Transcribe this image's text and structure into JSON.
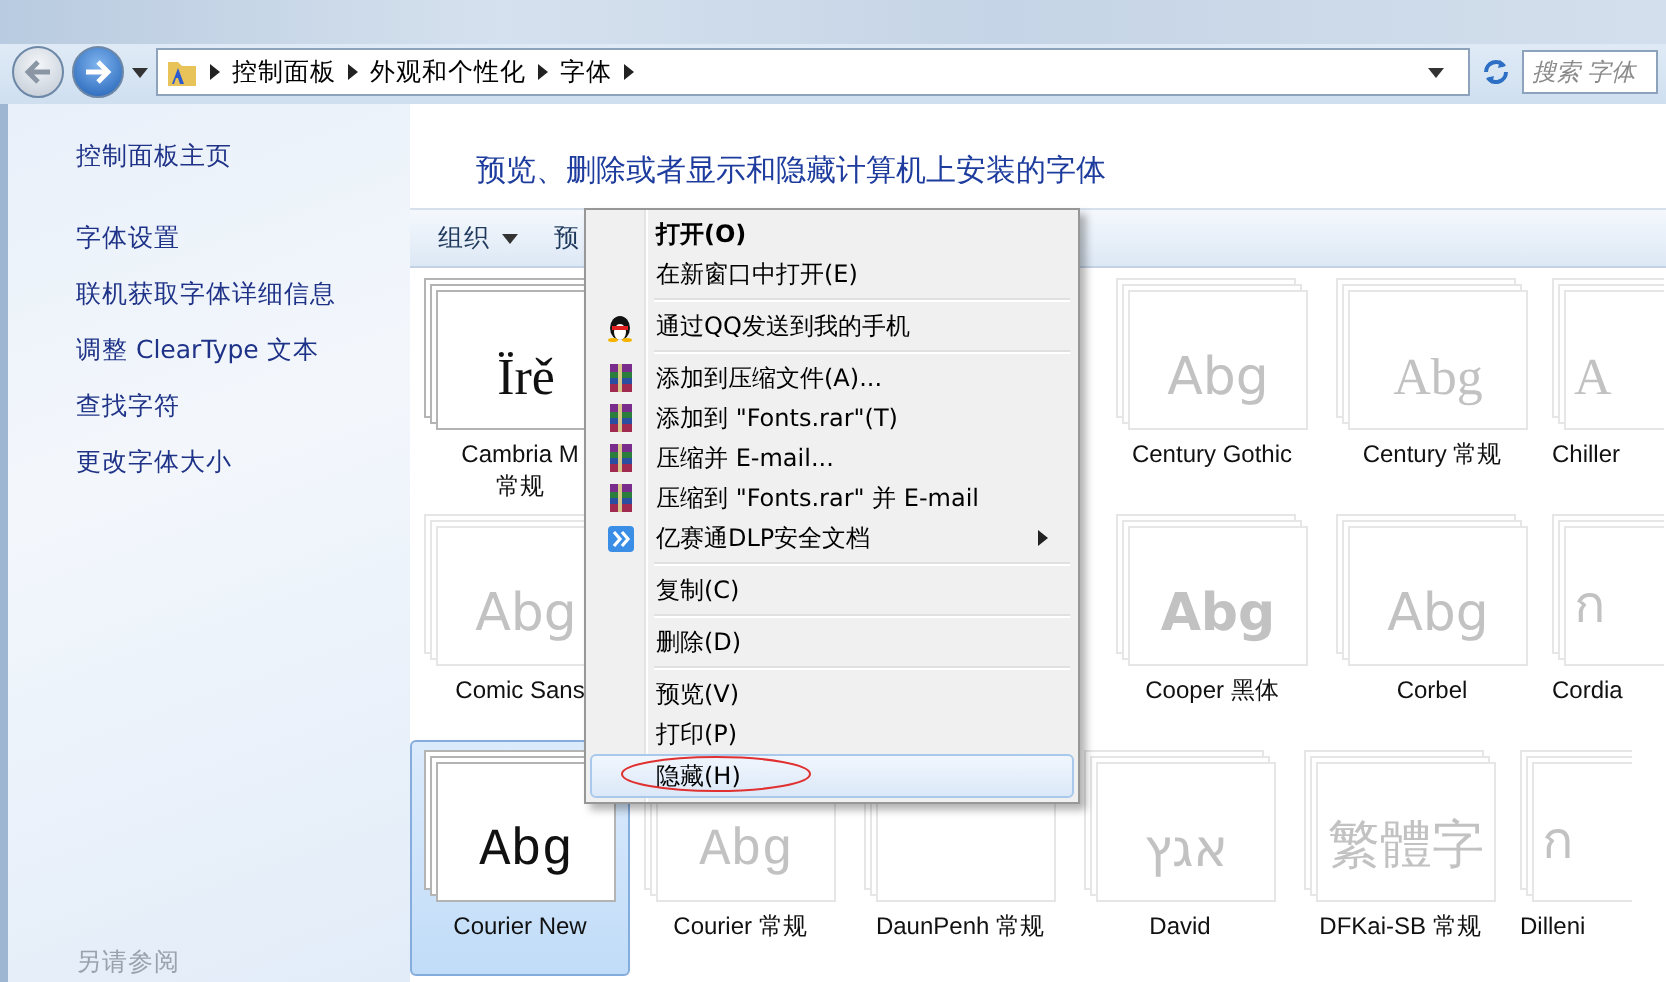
{
  "address_bar": {
    "crumbs": [
      "控制面板",
      "外观和个性化",
      "字体"
    ]
  },
  "search": {
    "placeholder": "搜索 字体"
  },
  "sidebar": {
    "items": [
      "控制面板主页",
      "字体设置",
      "联机获取字体详细信息",
      "调整 ClearType 文本",
      "查找字符",
      "更改字体大小"
    ],
    "footer": "另请参阅"
  },
  "heading": "预览、删除或者显示和隐藏计算机上安装的字体",
  "toolbar": {
    "items": [
      {
        "label": "组织",
        "dropdown": true
      },
      {
        "label": "预",
        "dropdown": false
      }
    ]
  },
  "font_rows": [
    {
      "left": [
        {
          "preview": "Ïrě",
          "lines": [
            "Cambria M",
            "常规"
          ],
          "hidden": false,
          "selected": false,
          "kind": "serif"
        }
      ],
      "right": [
        {
          "preview": "Abg",
          "lines": [
            "Century Gothic"
          ],
          "hidden": true,
          "selected": false,
          "kind": "sans"
        },
        {
          "preview": "Abg",
          "lines": [
            "Century 常规"
          ],
          "hidden": true,
          "selected": false,
          "kind": "serif"
        },
        {
          "preview": "A",
          "lines": [
            "Chiller"
          ],
          "hidden": true,
          "selected": false,
          "kind": "serif"
        }
      ]
    },
    {
      "left": [
        {
          "preview": "Abg",
          "lines": [
            "Comic Sans"
          ],
          "hidden": true,
          "selected": false,
          "kind": "sans"
        }
      ],
      "right": [
        {
          "preview": "Abg",
          "lines": [
            "Cooper 黑体"
          ],
          "hidden": true,
          "selected": false,
          "kind": "bold"
        },
        {
          "preview": "Abg",
          "lines": [
            "Corbel"
          ],
          "hidden": true,
          "selected": false,
          "kind": "sans"
        },
        {
          "preview": "ก",
          "lines": [
            "Cordia"
          ],
          "hidden": true,
          "selected": false,
          "kind": "sans"
        }
      ]
    },
    {
      "left": [
        {
          "preview": "Abg",
          "lines": [
            "Courier New"
          ],
          "hidden": false,
          "selected": true,
          "kind": "mono"
        },
        {
          "preview": "Abg",
          "lines": [
            "Courier 常规"
          ],
          "hidden": true,
          "selected": false,
          "kind": "mono"
        },
        {
          "lines": [
            "DaunPenh 常规"
          ],
          "hidden": true,
          "selected": false
        },
        {
          "preview": "אגץ",
          "lines": [
            "David"
          ],
          "hidden": true,
          "selected": false,
          "kind": "sans"
        },
        {
          "preview": "繁體字",
          "lines": [
            "DFKai-SB 常规"
          ],
          "hidden": true,
          "selected": false,
          "kind": "serif"
        },
        {
          "preview": "ก",
          "lines": [
            "Dilleni"
          ],
          "hidden": true,
          "selected": false,
          "kind": "sans"
        }
      ]
    }
  ],
  "context_menu": {
    "groups": [
      [
        {
          "label": "打开(O)",
          "default": true,
          "highlighted": false
        },
        {
          "label": "在新窗口中打开(E)",
          "highlighted": false
        }
      ],
      [
        {
          "label": "通过QQ发送到我的手机",
          "kind": "qq",
          "highlighted": false
        }
      ],
      [
        {
          "label": "添加到压缩文件(A)...",
          "kind": "archive",
          "highlighted": false
        },
        {
          "label": "添加到 \"Fonts.rar\"(T)",
          "kind": "archive",
          "highlighted": false
        },
        {
          "label": "压缩并 E-mail...",
          "kind": "archive",
          "highlighted": false
        },
        {
          "label": "压缩到 \"Fonts.rar\" 并 E-mail",
          "kind": "archive",
          "highlighted": false
        },
        {
          "label": "亿赛通DLP安全文档",
          "kind": "dlp",
          "submenu": true,
          "highlighted": false
        }
      ],
      [
        {
          "label": "复制(C)",
          "highlighted": false
        }
      ],
      [
        {
          "label": "删除(D)",
          "highlighted": false
        }
      ],
      [
        {
          "label": "预览(V)",
          "highlighted": false
        },
        {
          "label": "打印(P)",
          "highlighted": false
        },
        {
          "label": "隐藏(H)",
          "highlighted": true,
          "circled": true
        }
      ]
    ]
  }
}
